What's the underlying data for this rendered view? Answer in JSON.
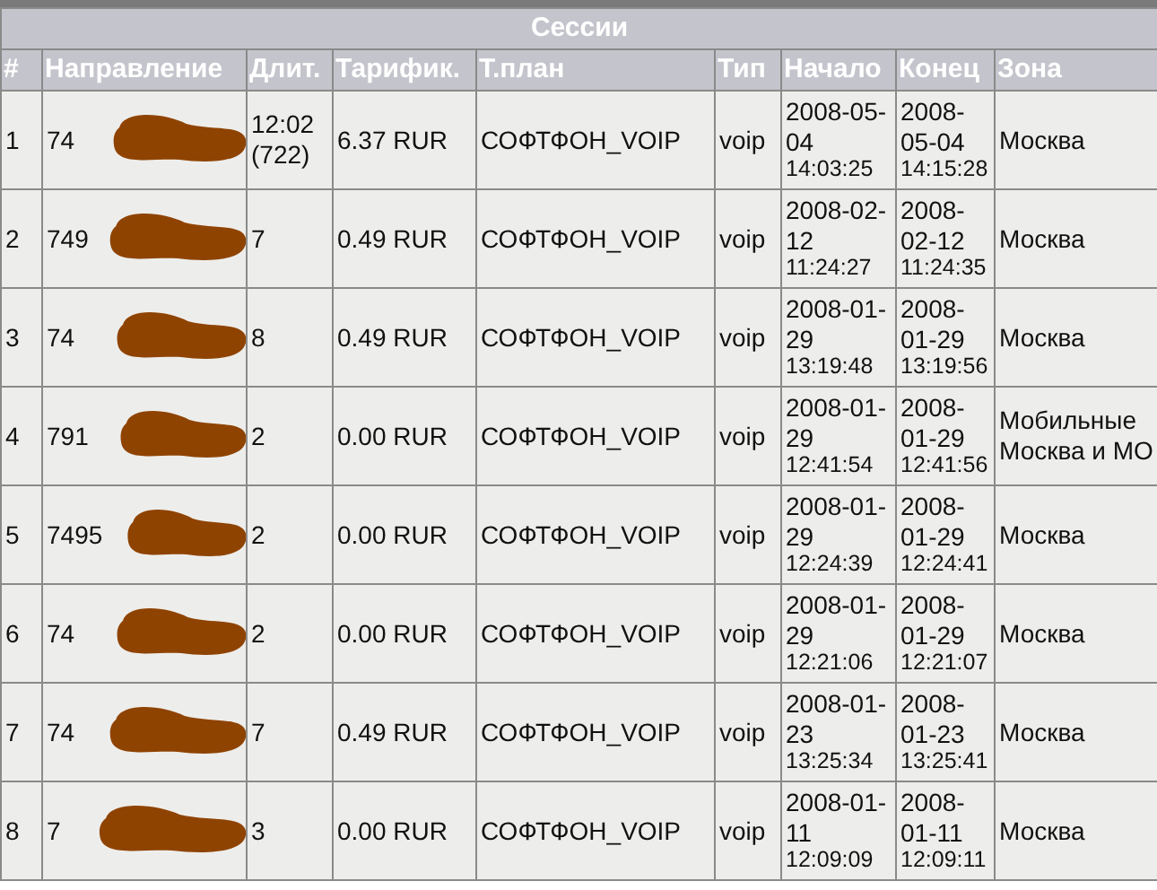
{
  "table": {
    "title": "Сессии",
    "columns": [
      "#",
      "Направление",
      "Длит.",
      "Тарифик.",
      "Т.план",
      "Тип",
      "Начало",
      "Конец",
      "Зона"
    ],
    "rows": [
      {
        "number": "1",
        "direction": "74",
        "duration": "12:02 (722)",
        "charge": "6.37 RUR",
        "plan": "СОФТФОН_VOIP",
        "type": "voip",
        "start_date": "2008-05-04",
        "start_time": "14:03:25",
        "end_date": "2008-05-04",
        "end_time": "14:15:28",
        "zone": "Москва"
      },
      {
        "number": "2",
        "direction": "749",
        "duration": "7",
        "charge": "0.49 RUR",
        "plan": "СОФТФОН_VOIP",
        "type": "voip",
        "start_date": "2008-02-12",
        "start_time": "11:24:27",
        "end_date": "2008-02-12",
        "end_time": "11:24:35",
        "zone": "Москва"
      },
      {
        "number": "3",
        "direction": "74",
        "duration": "8",
        "charge": "0.49 RUR",
        "plan": "СОФТФОН_VOIP",
        "type": "voip",
        "start_date": "2008-01-29",
        "start_time": "13:19:48",
        "end_date": "2008-01-29",
        "end_time": "13:19:56",
        "zone": "Москва"
      },
      {
        "number": "4",
        "direction": "791",
        "duration": "2",
        "charge": "0.00 RUR",
        "plan": "СОФТФОН_VOIP",
        "type": "voip",
        "start_date": "2008-01-29",
        "start_time": "12:41:54",
        "end_date": "2008-01-29",
        "end_time": "12:41:56",
        "zone": "Мобильные Москва и МО"
      },
      {
        "number": "5",
        "direction": "7495",
        "duration": "2",
        "charge": "0.00 RUR",
        "plan": "СОФТФОН_VOIP",
        "type": "voip",
        "start_date": "2008-01-29",
        "start_time": "12:24:39",
        "end_date": "2008-01-29",
        "end_time": "12:24:41",
        "zone": "Москва"
      },
      {
        "number": "6",
        "direction": "74",
        "duration": "2",
        "charge": "0.00 RUR",
        "plan": "СОФТФОН_VOIP",
        "type": "voip",
        "start_date": "2008-01-29",
        "start_time": "12:21:06",
        "end_date": "2008-01-29",
        "end_time": "12:21:07",
        "zone": "Москва"
      },
      {
        "number": "7",
        "direction": "74",
        "duration": "7",
        "charge": "0.49 RUR",
        "plan": "СОФТФОН_VOIP",
        "type": "voip",
        "start_date": "2008-01-23",
        "start_time": "13:25:34",
        "end_date": "2008-01-23",
        "end_time": "13:25:41",
        "zone": "Москва"
      },
      {
        "number": "8",
        "direction": "7",
        "duration": "3",
        "charge": "0.00 RUR",
        "plan": "СОФТФОН_VOIP",
        "type": "voip",
        "start_date": "2008-01-11",
        "start_time": "12:09:09",
        "end_date": "2008-01-11",
        "end_time": "12:09:11",
        "zone": "Москва"
      }
    ]
  }
}
